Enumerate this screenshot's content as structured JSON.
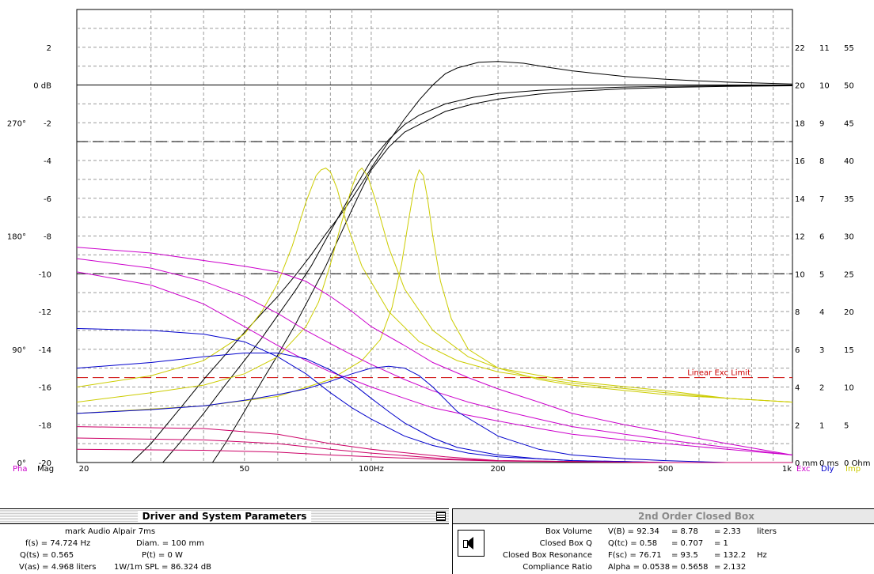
{
  "chart_data": {
    "type": "line",
    "x_scale": "log",
    "xlim": [
      20,
      1000
    ],
    "ylim": [
      -20,
      4
    ],
    "grid": true,
    "x_ticks": [
      {
        "v": 20,
        "label": "20"
      },
      {
        "v": 50,
        "label": "50"
      },
      {
        "v": 100,
        "label": "100Hz"
      },
      {
        "v": 200,
        "label": "200"
      },
      {
        "v": 500,
        "label": "500"
      },
      {
        "v": 1000,
        "label": "1k"
      }
    ],
    "x_label_left": "Mag",
    "y_ticks": [
      {
        "v": 2,
        "label": "2"
      },
      {
        "v": 0,
        "label": "0 dB"
      },
      {
        "v": -2,
        "label": "-2"
      },
      {
        "v": -4,
        "label": "-4"
      },
      {
        "v": -6,
        "label": "-6"
      },
      {
        "v": -8,
        "label": "-8"
      },
      {
        "v": -10,
        "label": "-10"
      },
      {
        "v": -12,
        "label": "-12"
      },
      {
        "v": -14,
        "label": "-14"
      },
      {
        "v": -16,
        "label": "-16"
      },
      {
        "v": -18,
        "label": "-18"
      },
      {
        "v": -20,
        "label": "-20"
      }
    ],
    "phase_ticks": [
      {
        "v": -2,
        "label": "270°"
      },
      {
        "v": -8,
        "label": "180°"
      },
      {
        "v": -14,
        "label": "90°"
      },
      {
        "v": -20,
        "label": "0°"
      }
    ],
    "phase_axis_label": "Pha",
    "right_axes": [
      {
        "label": "Exc",
        "color": "#cc00cc",
        "ticks": [
          "22",
          "20",
          "18",
          "16",
          "14",
          "12",
          "10",
          "8",
          "6",
          "4",
          "2",
          "0 mm"
        ]
      },
      {
        "label": "Dly",
        "color": "#0000cc",
        "ticks": [
          "11",
          "10",
          "9",
          "8",
          "7",
          "6",
          "5",
          "4",
          "3",
          "2",
          "1",
          "0 ms"
        ]
      },
      {
        "label": "Imp",
        "color": "#cccc00",
        "ticks": [
          "55",
          "50",
          "45",
          "40",
          "35",
          "30",
          "25",
          "20",
          "15",
          "10",
          "5",
          "0 Ohm"
        ]
      }
    ],
    "reference_lines": [
      {
        "y": -3,
        "style": "dash",
        "color": "#000000"
      },
      {
        "y": -10,
        "style": "dash",
        "color": "#000000"
      },
      {
        "y": -15.5,
        "style": "dash",
        "color": "#cc0000",
        "label": "Linear Exc Limit"
      }
    ],
    "series": [
      {
        "group": "magnitude",
        "color": "#000000",
        "x": [
          27,
          30,
          35,
          40,
          45,
          50,
          55,
          60,
          66,
          72,
          78,
          85,
          90,
          95,
          100,
          110,
          120,
          130,
          140,
          150,
          160,
          180,
          200,
          230,
          260,
          300,
          400,
          500,
          700,
          1000
        ],
        "y": [
          -20,
          -19,
          -17.2,
          -15.6,
          -14.3,
          -13.1,
          -12.1,
          -11.2,
          -10.1,
          -9,
          -7.9,
          -6.8,
          -6,
          -5.2,
          -4.4,
          -3,
          -1.8,
          -0.8,
          0,
          0.6,
          0.9,
          1.2,
          1.25,
          1.15,
          0.95,
          0.75,
          0.45,
          0.3,
          0.15,
          0.05
        ]
      },
      {
        "group": "magnitude",
        "color": "#000000",
        "x": [
          32,
          35,
          40,
          45,
          50,
          55,
          60,
          66,
          72,
          78,
          85,
          90,
          100,
          110,
          120,
          130,
          150,
          175,
          200,
          250,
          300,
          400,
          500,
          700,
          1000
        ],
        "y": [
          -20,
          -19,
          -17.4,
          -15.9,
          -14.6,
          -13.4,
          -12.2,
          -10.9,
          -9.6,
          -8.2,
          -6.7,
          -5.7,
          -4,
          -2.9,
          -2.1,
          -1.6,
          -1,
          -0.65,
          -0.45,
          -0.28,
          -0.2,
          -0.11,
          -0.07,
          -0.04,
          -0.02
        ]
      },
      {
        "group": "magnitude",
        "color": "#000000",
        "x": [
          42,
          45,
          50,
          55,
          60,
          66,
          72,
          78,
          85,
          90,
          95,
          100,
          110,
          120,
          130,
          150,
          175,
          200,
          250,
          300,
          400,
          500,
          700,
          1000
        ],
        "y": [
          -20,
          -19,
          -17.3,
          -15.7,
          -14.3,
          -12.7,
          -11.1,
          -9.6,
          -7.8,
          -6.6,
          -5.5,
          -4.5,
          -3.3,
          -2.5,
          -2.1,
          -1.4,
          -1,
          -0.75,
          -0.48,
          -0.34,
          -0.2,
          -0.13,
          -0.07,
          -0.04
        ]
      },
      {
        "group": "impedance",
        "color": "#cccc00",
        "x": [
          20,
          30,
          40,
          50,
          55,
          60,
          65,
          70,
          74,
          76,
          78,
          80,
          83,
          87,
          95,
          110,
          130,
          160,
          200,
          300,
          500,
          700,
          1000
        ],
        "y": [
          -16,
          -15.4,
          -14.6,
          -13.2,
          -12,
          -10.5,
          -8.5,
          -6.2,
          -4.8,
          -4.5,
          -4.4,
          -4.6,
          -5.5,
          -7.2,
          -9.6,
          -12,
          -13.6,
          -14.6,
          -15.2,
          -15.8,
          -16.3,
          -16.6,
          -16.8
        ]
      },
      {
        "group": "impedance",
        "color": "#cccc00",
        "x": [
          20,
          30,
          40,
          50,
          60,
          70,
          75,
          80,
          85,
          90,
          93,
          95,
          98,
          102,
          110,
          120,
          140,
          170,
          200,
          300,
          500,
          700,
          1000
        ],
        "y": [
          -16.8,
          -16.3,
          -15.9,
          -15.3,
          -14.4,
          -12.8,
          -11.5,
          -9.5,
          -7.3,
          -5.4,
          -4.6,
          -4.4,
          -4.8,
          -6,
          -8.6,
          -10.8,
          -13,
          -14.4,
          -15,
          -15.7,
          -16.2,
          -16.6,
          -16.8
        ]
      },
      {
        "group": "impedance",
        "color": "#cccc00",
        "x": [
          20,
          40,
          60,
          80,
          95,
          105,
          112,
          118,
          123,
          127,
          130,
          133,
          136,
          140,
          146,
          155,
          170,
          200,
          250,
          300,
          500,
          700,
          1000
        ],
        "y": [
          -17.4,
          -17,
          -16.5,
          -15.6,
          -14.6,
          -13.5,
          -11.8,
          -9.5,
          -7,
          -5.2,
          -4.5,
          -4.8,
          -6,
          -8,
          -10.4,
          -12.4,
          -14,
          -15,
          -15.6,
          -15.9,
          -16.4,
          -16.6,
          -16.8
        ]
      },
      {
        "group": "phase",
        "color": "#cc00cc",
        "x": [
          20,
          30,
          40,
          50,
          60,
          70,
          80,
          90,
          100,
          120,
          140,
          170,
          200,
          250,
          300,
          400,
          500,
          700,
          1000
        ],
        "y": [
          -8.6,
          -8.9,
          -9.3,
          -9.6,
          -9.9,
          -10.4,
          -11.2,
          -12,
          -12.8,
          -13.8,
          -14.7,
          -15.5,
          -16.1,
          -16.8,
          -17.4,
          -18,
          -18.4,
          -19,
          -19.6
        ]
      },
      {
        "group": "phase",
        "color": "#cc00cc",
        "x": [
          20,
          30,
          40,
          50,
          60,
          70,
          80,
          90,
          100,
          120,
          140,
          170,
          200,
          250,
          300,
          400,
          500,
          700,
          1000
        ],
        "y": [
          -9.2,
          -9.7,
          -10.4,
          -11.2,
          -12.1,
          -13,
          -13.7,
          -14.3,
          -14.8,
          -15.6,
          -16.2,
          -16.8,
          -17.2,
          -17.7,
          -18.1,
          -18.5,
          -18.8,
          -19.2,
          -19.6
        ]
      },
      {
        "group": "phase",
        "color": "#cc00cc",
        "x": [
          20,
          30,
          40,
          50,
          60,
          70,
          80,
          90,
          100,
          120,
          140,
          170,
          200,
          250,
          300,
          400,
          500,
          700,
          1000
        ],
        "y": [
          -9.9,
          -10.6,
          -11.6,
          -12.8,
          -13.8,
          -14.6,
          -15.2,
          -15.6,
          -16,
          -16.6,
          -17.1,
          -17.5,
          -17.8,
          -18.2,
          -18.5,
          -18.8,
          -19,
          -19.3,
          -19.6
        ]
      },
      {
        "group": "excursion",
        "color": "#0000cc",
        "x": [
          20,
          30,
          40,
          50,
          60,
          70,
          80,
          90,
          100,
          120,
          140,
          170,
          200,
          250,
          300,
          400,
          500,
          700,
          1000
        ],
        "y": [
          -12.9,
          -13,
          -13.2,
          -13.6,
          -14.4,
          -15.3,
          -16.3,
          -17.1,
          -17.7,
          -18.6,
          -19.1,
          -19.5,
          -19.7,
          -19.8,
          -19.9,
          -19.95,
          -20,
          -20,
          -20
        ]
      },
      {
        "group": "delay",
        "color": "#0000cc",
        "x": [
          20,
          30,
          40,
          50,
          60,
          70,
          80,
          90,
          100,
          110,
          120,
          140,
          160,
          200,
          250,
          300,
          400,
          500,
          700,
          1000
        ],
        "y": [
          -15,
          -14.7,
          -14.4,
          -14.2,
          -14.2,
          -14.5,
          -15.1,
          -15.8,
          -16.6,
          -17.3,
          -17.9,
          -18.7,
          -19.2,
          -19.6,
          -19.8,
          -19.9,
          -19.95,
          -20,
          -20,
          -20
        ]
      },
      {
        "group": "delay",
        "color": "#0000cc",
        "x": [
          20,
          30,
          40,
          50,
          60,
          70,
          80,
          90,
          100,
          110,
          120,
          130,
          140,
          160,
          200,
          250,
          300,
          400,
          500,
          700,
          1000
        ],
        "y": [
          -17.4,
          -17.2,
          -17,
          -16.7,
          -16.4,
          -16.1,
          -15.7,
          -15.3,
          -15,
          -14.9,
          -15,
          -15.4,
          -16,
          -17.3,
          -18.6,
          -19.3,
          -19.6,
          -19.8,
          -19.9,
          -20,
          -20
        ]
      },
      {
        "group": "excursion",
        "color": "#cc0066",
        "x": [
          20,
          40,
          60,
          80,
          100,
          150,
          200,
          300,
          500,
          700,
          1000
        ],
        "y": [
          -18.1,
          -18.2,
          -18.5,
          -19,
          -19.3,
          -19.7,
          -19.9,
          -19.95,
          -20,
          -20,
          -20
        ]
      },
      {
        "group": "excursion",
        "color": "#cc0066",
        "x": [
          20,
          40,
          60,
          80,
          100,
          150,
          200,
          300,
          500,
          700,
          1000
        ],
        "y": [
          -18.7,
          -18.8,
          -19,
          -19.3,
          -19.5,
          -19.8,
          -19.9,
          -19.95,
          -20,
          -20,
          -20
        ]
      },
      {
        "group": "excursion",
        "color": "#cc0066",
        "x": [
          20,
          40,
          60,
          80,
          100,
          150,
          200,
          300,
          500,
          700,
          1000
        ],
        "y": [
          -19.3,
          -19.35,
          -19.45,
          -19.6,
          -19.7,
          -19.85,
          -19.92,
          -19.96,
          -20,
          -20,
          -20
        ]
      }
    ]
  },
  "driver_panel": {
    "title": "Driver and System Parameters",
    "driver_name": "mark Audio  Alpair 7ms",
    "fs": "f(s) = 74.724  Hz",
    "qts": "Q(ts) = 0.565",
    "vas": "V(as) = 4.968   liters",
    "diam": "Diam. =  100      mm",
    "pt": "P(t) =  0          W",
    "spl": "1W/1m SPL = 86.324  dB"
  },
  "box_panel": {
    "title": "2nd Order Closed Box",
    "rows": [
      {
        "label": "Box Volume",
        "sym": "V(B) = 92.34",
        "v2": "= 8.78",
        "v3": "= 2.33",
        "unit": "liters"
      },
      {
        "label": "Closed Box Q",
        "sym": "Q(tc) = 0.58",
        "v2": "= 0.707",
        "v3": "= 1",
        "unit": ""
      },
      {
        "label": "Closed Box Resonance",
        "sym": "F(sc) = 76.71",
        "v2": "= 93.5",
        "v3": "= 132.2",
        "unit": "Hz"
      },
      {
        "label": "Compliance Ratio",
        "sym": "Alpha = 0.0538",
        "v2": "= 0.5658",
        "v3": "= 2.132",
        "unit": ""
      }
    ]
  }
}
